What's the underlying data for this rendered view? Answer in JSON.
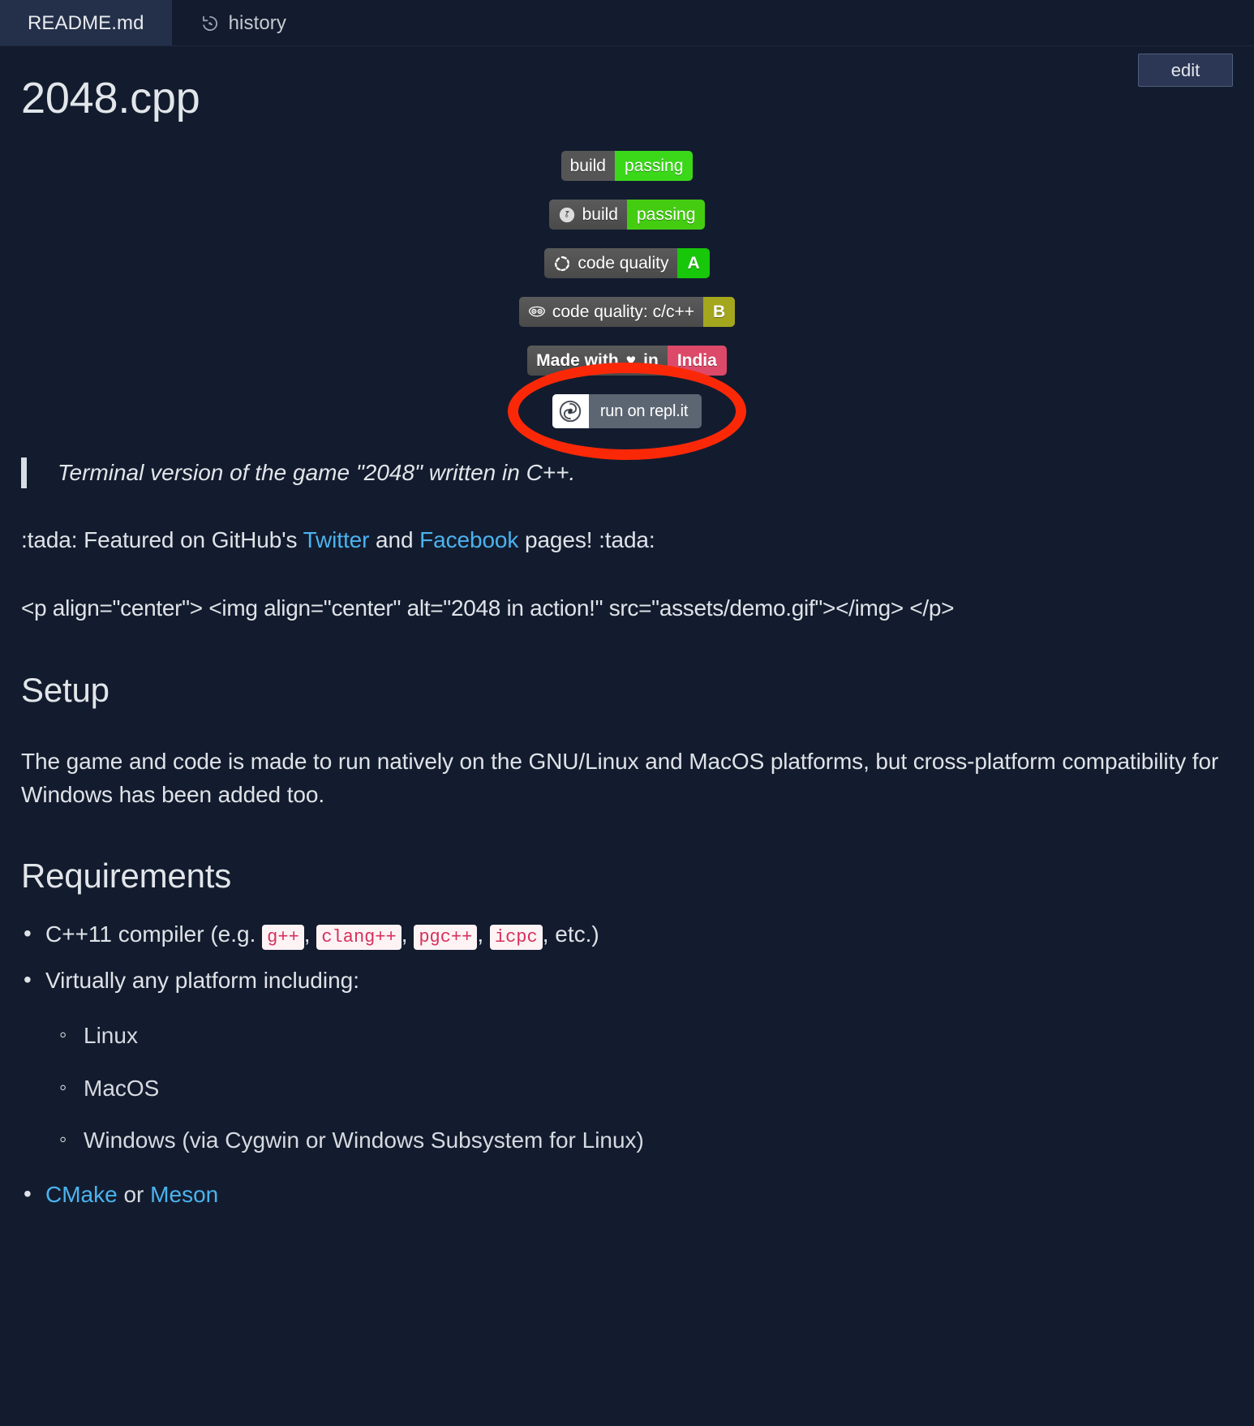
{
  "tabs": [
    {
      "label": "README.md",
      "icon": "",
      "active": true
    },
    {
      "label": "history",
      "icon": "history-icon",
      "active": false
    }
  ],
  "toolbar": {
    "edit_label": "edit"
  },
  "page_title": "2048.cpp",
  "badges": [
    {
      "name": "build-status-badge",
      "icon": "",
      "left_label": "build",
      "right_label": "passing",
      "right_color": "#3bd81a",
      "left_color": "#555555"
    },
    {
      "name": "travis-build-badge",
      "icon": "travis-ci-icon",
      "left_label": "build",
      "right_label": "passing",
      "right_color": "#44cc11",
      "left_color": "#555555"
    },
    {
      "name": "codebeat-quality-badge",
      "icon": "codebeat-icon",
      "left_label": "code quality",
      "right_label": "A",
      "right_color": "#18c60a",
      "left_color": "#555555"
    },
    {
      "name": "codacy-quality-badge",
      "icon": "codacy-icon",
      "left_label": "code quality: c/c++",
      "right_label": "B",
      "right_color": "#a4a61d",
      "left_color": "#555555"
    },
    {
      "name": "made-with-love-badge",
      "icon": "",
      "left_label_pre": "Made with",
      "left_label_heart": "♥",
      "left_label_post": "in",
      "right_label": "India",
      "right_color": "#dd4968",
      "left_color": "#555555"
    }
  ],
  "replit": {
    "name": "run-on-replit-badge",
    "label": "run on repl.it",
    "bg": "#5c6673",
    "annotation_color": "#fb2808"
  },
  "quote": "Terminal version of the game \"2048\" written in C++.",
  "featured": {
    "prefix": ":tada: Featured on GitHub's ",
    "link1": "Twitter",
    "middle": " and ",
    "link2": "Facebook",
    "suffix": " pages! :tada:"
  },
  "raw_html_line": "<p align=\"center\"> <img align=\"center\" alt=\"2048 in action!\" src=\"assets/demo.gif\"></img> </p>",
  "setup": {
    "heading": "Setup",
    "body": "The game and code is made to run natively on the GNU/Linux and MacOS platforms, but cross-platform compatibility for Windows has been added too."
  },
  "requirements": {
    "heading": "Requirements",
    "compiler_pre": "C++11 compiler (e.g. ",
    "compilers": [
      "g++",
      "clang++",
      "pgc++",
      "icpc"
    ],
    "compiler_post": ", etc.)",
    "platforms_label": "Virtually any platform including:",
    "platforms": [
      "Linux",
      "MacOS",
      "Windows (via Cygwin or Windows Subsystem for Linux)"
    ],
    "build_tools": {
      "link1": "CMake",
      "middle": " or ",
      "link2": "Meson"
    }
  },
  "colors": {
    "page_bg": "#131c2e",
    "tab_active_bg": "#243049",
    "text": "#dfe3e8",
    "link": "#4bb3ef",
    "code_text": "#d6305b",
    "code_bg": "#fdf3f5"
  }
}
